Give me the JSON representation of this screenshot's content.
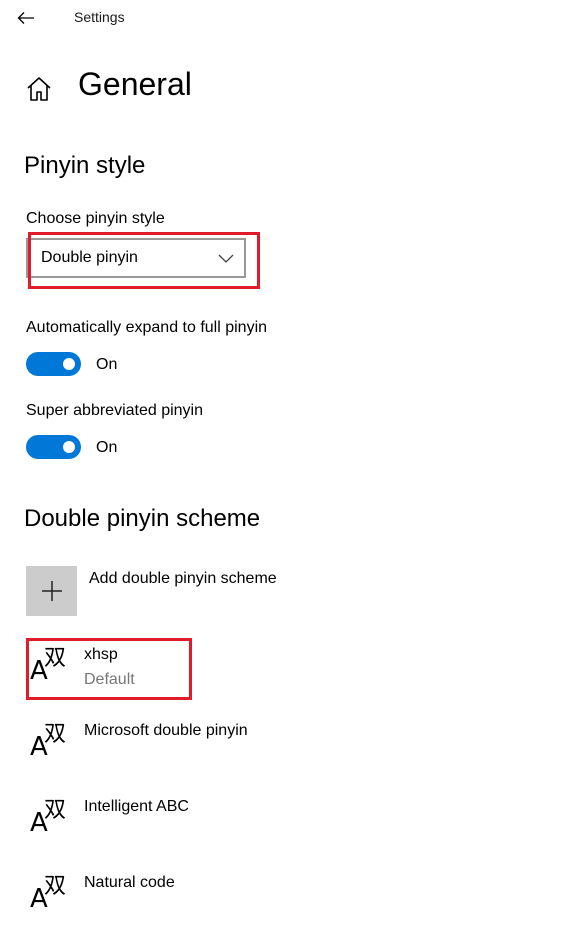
{
  "window": {
    "title": "Settings"
  },
  "header": {
    "title": "General"
  },
  "pinyin_style": {
    "section_title": "Pinyin style",
    "choose_label": "Choose pinyin style",
    "dropdown_value": "Double pinyin",
    "auto_expand": {
      "label": "Automatically expand to full pinyin",
      "state": "On"
    },
    "super_abbrev": {
      "label": "Super abbreviated pinyin",
      "state": "On"
    }
  },
  "scheme": {
    "section_title": "Double pinyin scheme",
    "add_label": "Add double pinyin scheme",
    "icon_letter": "A",
    "icon_glyph": "双",
    "items": [
      {
        "name": "xhsp",
        "sub": "Default"
      },
      {
        "name": "Microsoft double pinyin"
      },
      {
        "name": "Intelligent ABC"
      },
      {
        "name": "Natural code"
      }
    ]
  },
  "colors": {
    "accent": "#0078d7",
    "highlight": "#e01b2a",
    "tile": "#cccccc",
    "secondary_text": "#767676"
  }
}
